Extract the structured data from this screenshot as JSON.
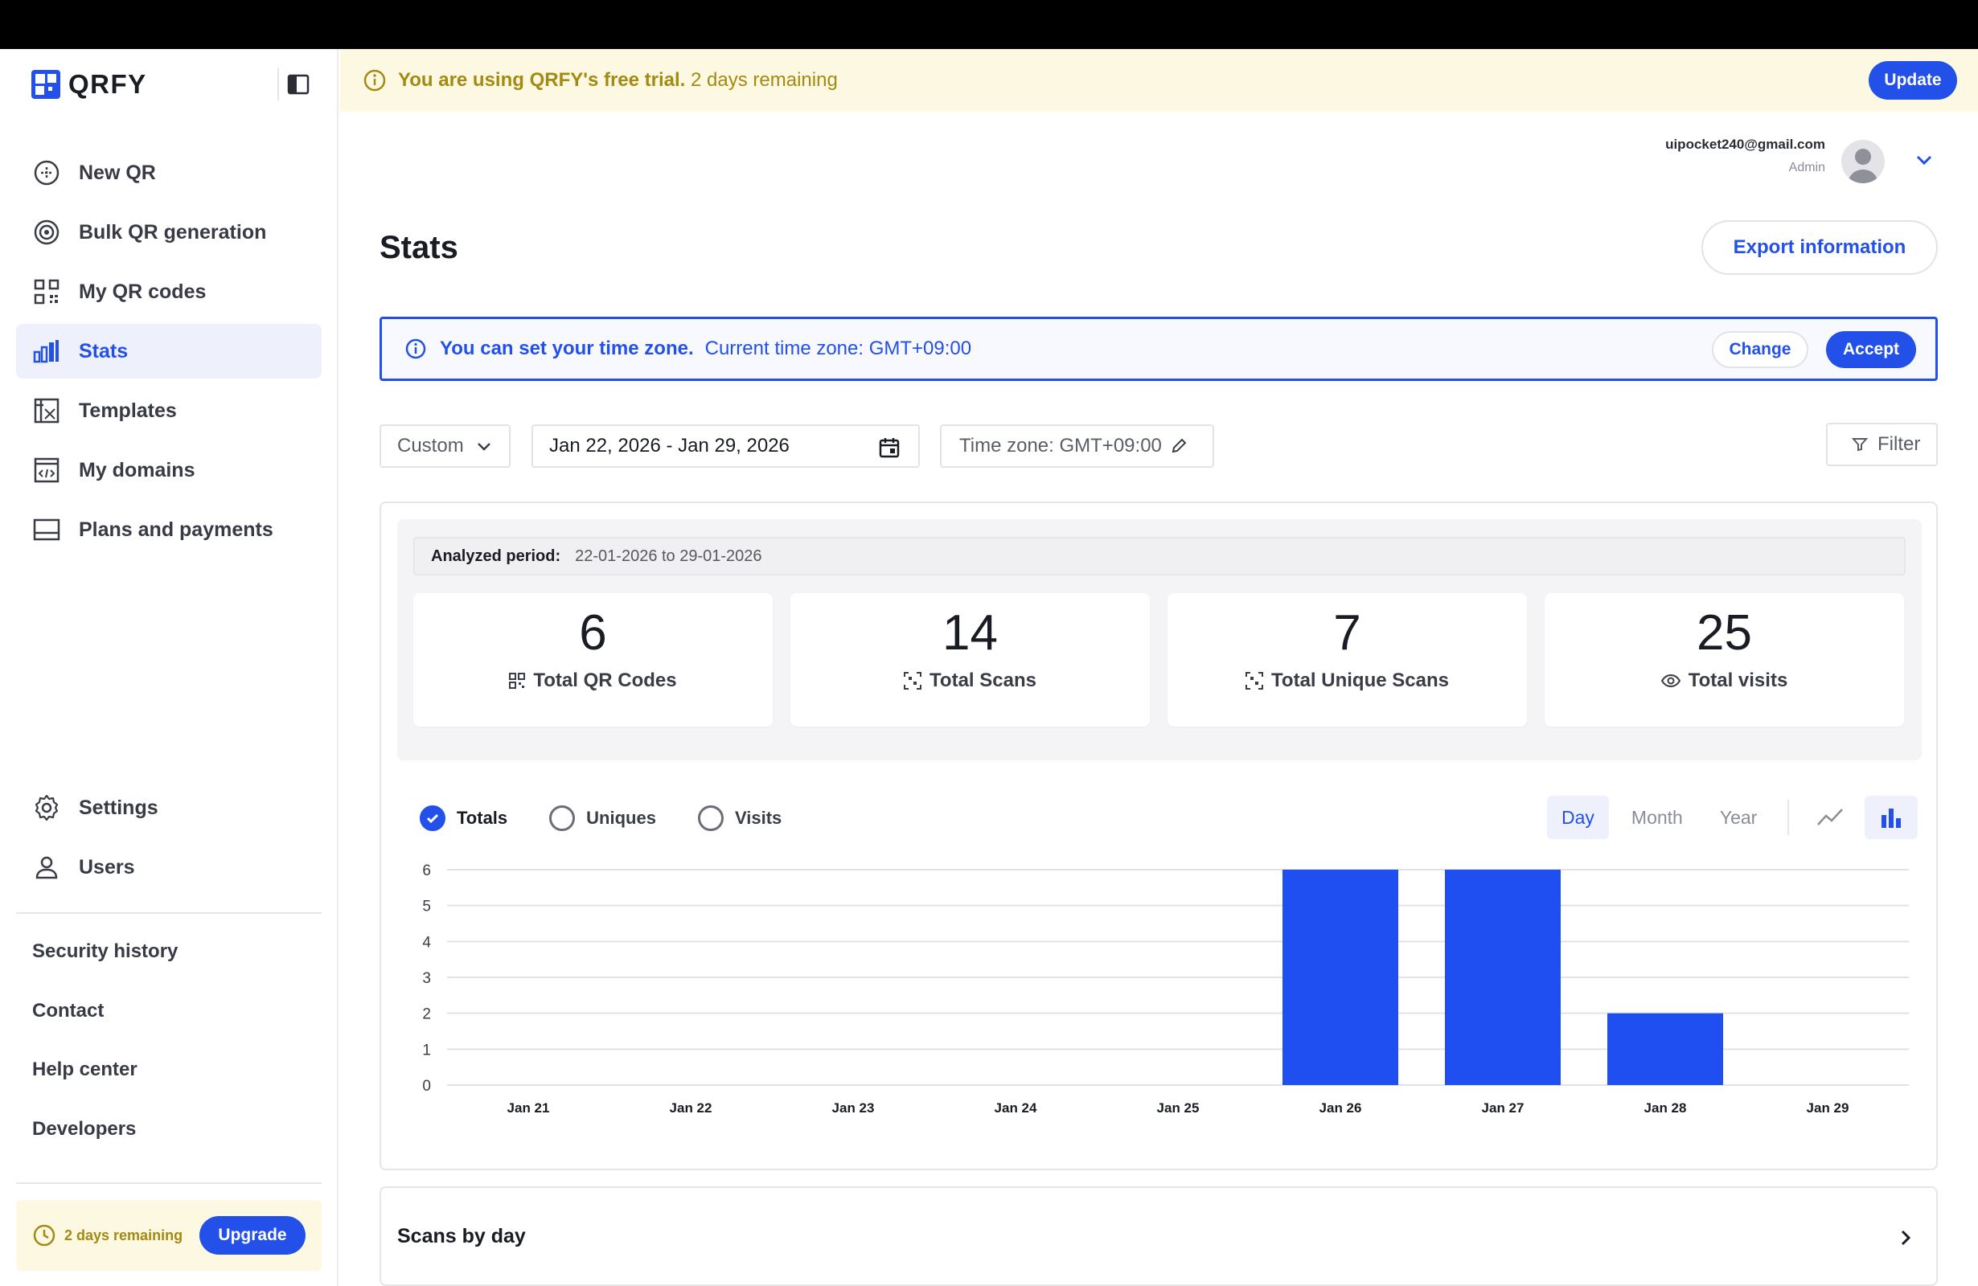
{
  "app": {
    "name": "QRFY"
  },
  "banner": {
    "trial_bold": "You are using QRFY's free trial.",
    "trial_rest": "2 days remaining",
    "update_label": "Update"
  },
  "user": {
    "email": "uipocket240@gmail.com",
    "role": "Admin"
  },
  "sidebar": {
    "items": [
      {
        "label": "New QR",
        "icon": "plus-circle-icon"
      },
      {
        "label": "Bulk QR generation",
        "icon": "target-icon"
      },
      {
        "label": "My QR codes",
        "icon": "qr-grid-icon"
      },
      {
        "label": "Stats",
        "icon": "bar-chart-icon",
        "active": true
      },
      {
        "label": "Templates",
        "icon": "template-icon"
      },
      {
        "label": "My domains",
        "icon": "domain-icon"
      },
      {
        "label": "Plans and payments",
        "icon": "card-icon"
      }
    ],
    "bottom_items": [
      {
        "label": "Settings",
        "icon": "gear-icon"
      },
      {
        "label": "Users",
        "icon": "user-icon"
      }
    ],
    "links": [
      "Security history",
      "Contact",
      "Help center",
      "Developers"
    ],
    "trial": {
      "text": "2 days remaining",
      "upgrade_label": "Upgrade"
    }
  },
  "page": {
    "title": "Stats",
    "export_label": "Export information"
  },
  "timezone_banner": {
    "strong": "You can set your time zone.",
    "current": "Current time zone: GMT+09:00",
    "change_label": "Change",
    "accept_label": "Accept"
  },
  "filters": {
    "range_select": "Custom",
    "date_range": "Jan 22, 2026 - Jan 29, 2026",
    "timezone": "Time zone: GMT+09:00",
    "filter_label": "Filter"
  },
  "summary": {
    "period_label": "Analyzed period:",
    "period_value": "22-01-2026 to 29-01-2026",
    "kpis": [
      {
        "value": "6",
        "label": "Total QR Codes",
        "icon": "qr-icon"
      },
      {
        "value": "14",
        "label": "Total Scans",
        "icon": "scan-icon"
      },
      {
        "value": "7",
        "label": "Total Unique Scans",
        "icon": "scan-icon"
      },
      {
        "value": "25",
        "label": "Total visits",
        "icon": "eye-icon"
      }
    ]
  },
  "chart_controls": {
    "series_toggles": [
      {
        "label": "Totals",
        "checked": true
      },
      {
        "label": "Uniques",
        "checked": false
      },
      {
        "label": "Visits",
        "checked": false
      }
    ],
    "period_tabs": [
      "Day",
      "Month",
      "Year"
    ],
    "active_tab": "Day",
    "chart_types": [
      "line-chart-icon",
      "bar-chart-icon"
    ],
    "active_type": "bar"
  },
  "chart_data": {
    "type": "bar",
    "categories": [
      "Jan 21",
      "Jan 22",
      "Jan 23",
      "Jan 24",
      "Jan 25",
      "Jan 26",
      "Jan 27",
      "Jan 28",
      "Jan 29"
    ],
    "values": [
      0,
      0,
      0,
      0,
      0,
      6,
      6,
      2,
      0
    ],
    "yticks": [
      0,
      1,
      2,
      3,
      4,
      5,
      6
    ],
    "ylim": [
      0,
      6
    ],
    "grid": true,
    "color": "#1f4ff0"
  },
  "sections": {
    "scans_by_day": "Scans by day"
  },
  "colors": {
    "accent": "#2250e8",
    "trial_text": "#a38a10",
    "trial_bg": "#fdf8e2",
    "bar": "#1f4ff0"
  }
}
